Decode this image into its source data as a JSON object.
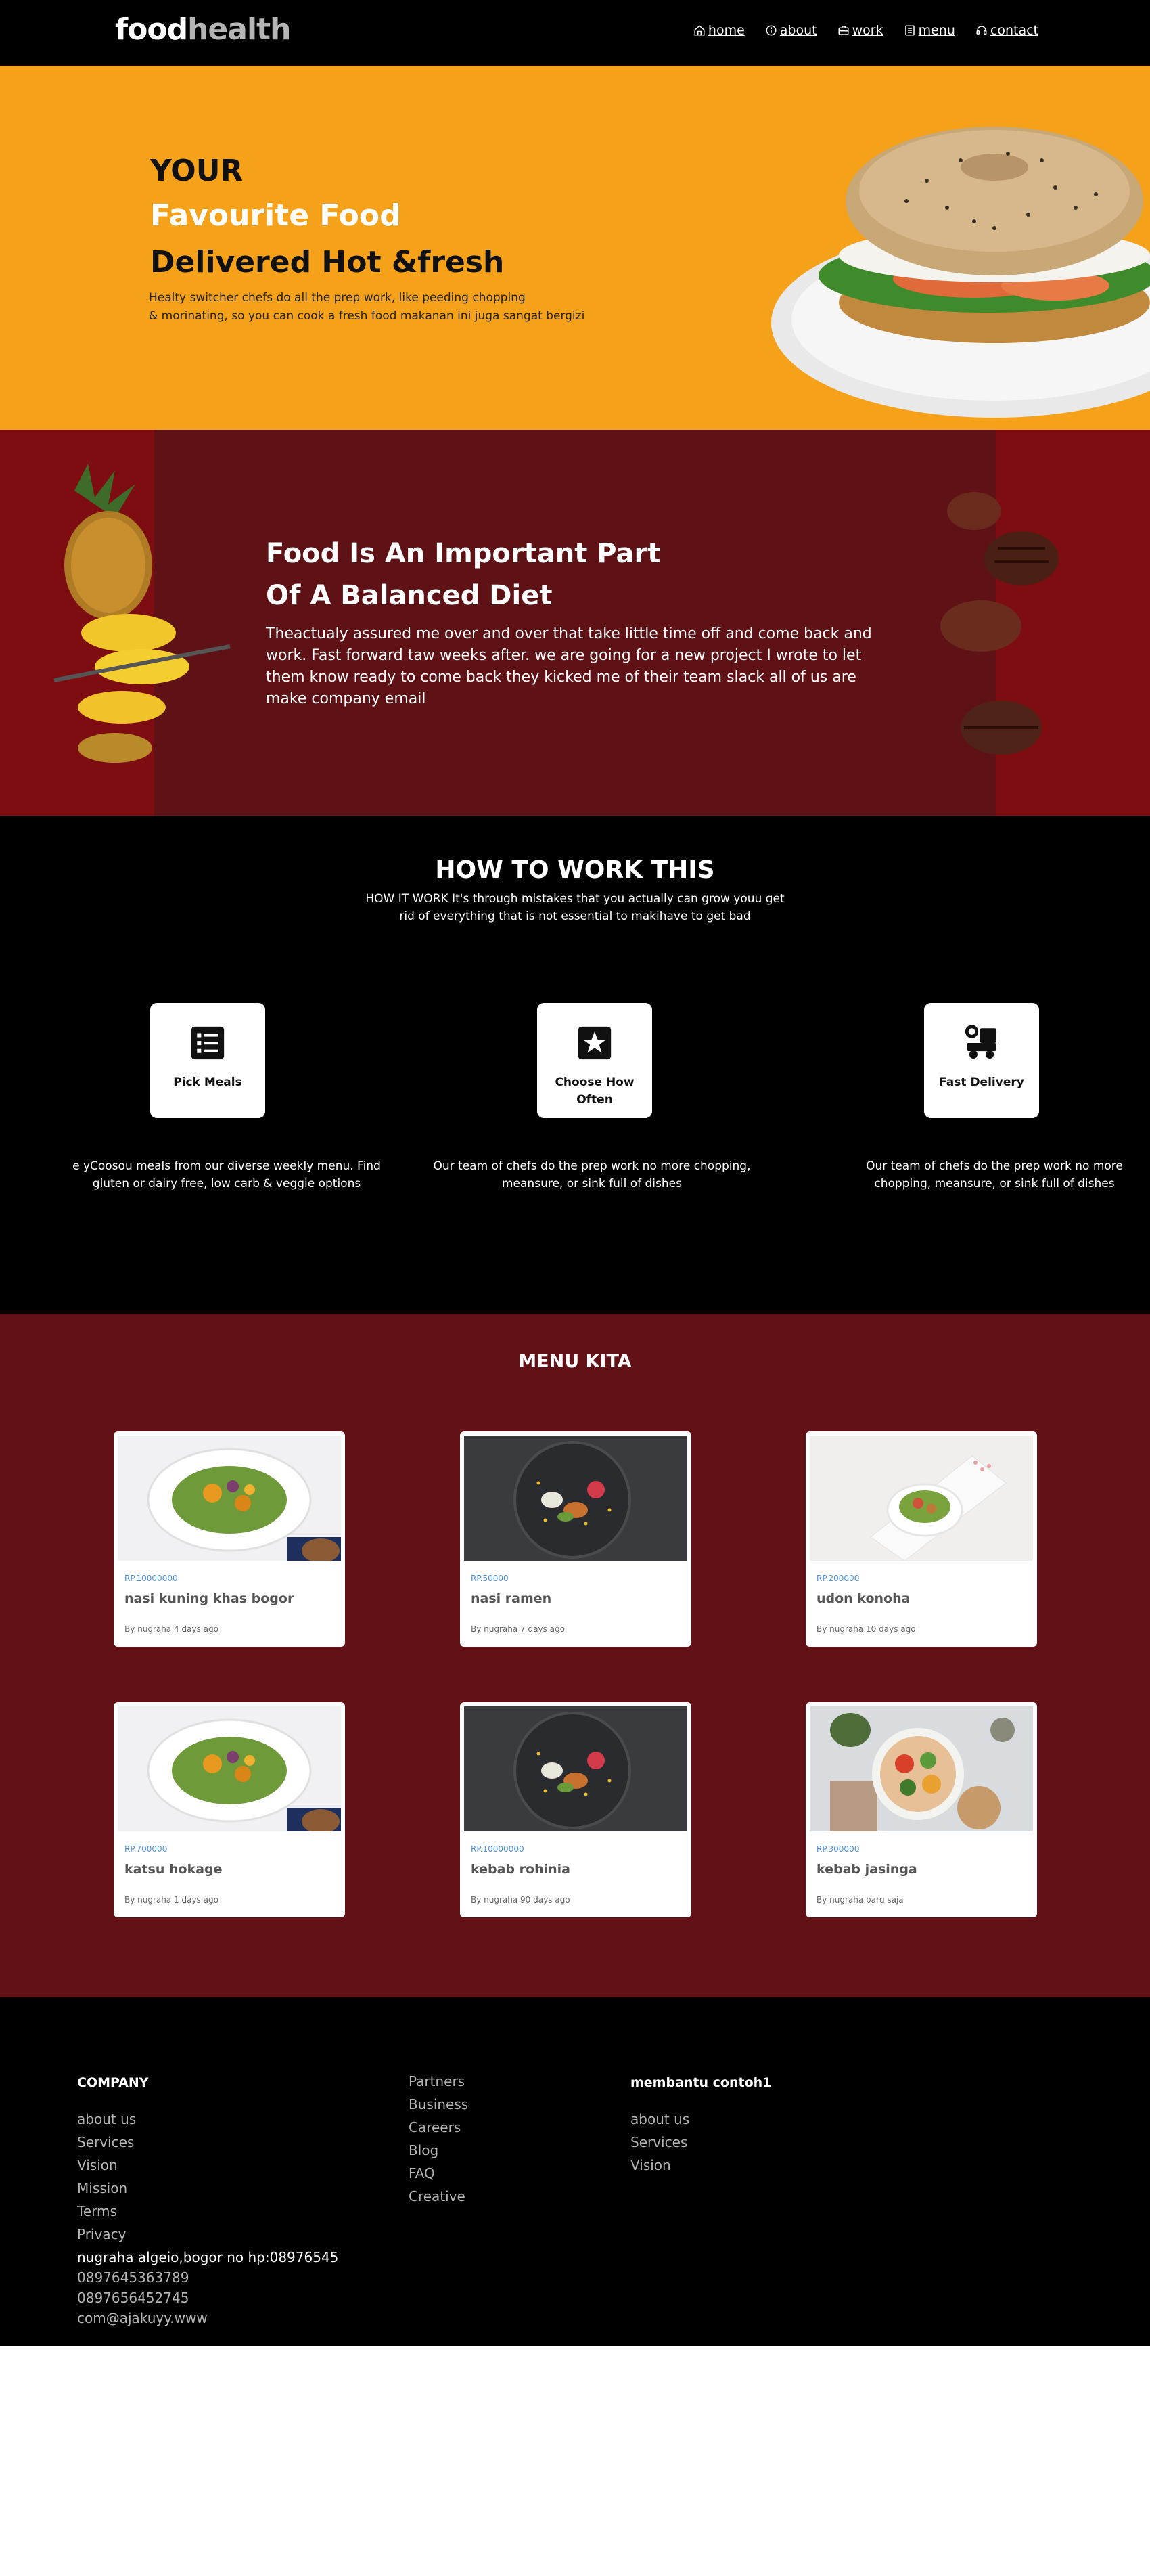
{
  "brand": {
    "part1": "food",
    "part2": "health"
  },
  "nav": [
    {
      "label": "home",
      "icon": "home-icon"
    },
    {
      "label": "about",
      "icon": "info-icon"
    },
    {
      "label": "work",
      "icon": "briefcase-icon"
    },
    {
      "label": "menu",
      "icon": "menu-list-icon"
    },
    {
      "label": "contact",
      "icon": "headset-icon"
    }
  ],
  "hero": {
    "line1": "YOUR",
    "line2": "Favourite Food",
    "line3": "Delivered Hot &fresh",
    "desc_line1": "Healty switcher chefs do all the prep work, like peeding chopping",
    "desc_line2": "& morinating, so you can cook a fresh food makanan ini juga sangat bergizi"
  },
  "diet": {
    "title_line1": "Food Is An Important Part",
    "title_line2": "Of A Balanced Diet",
    "text": "Theactualy assured me over and over that take little time off and come back and work. Fast forward taw weeks after. we are going for a new project I wrote to let them know ready to come back they kicked me of their team slack all of us are make company email"
  },
  "how": {
    "title": "HOW TO WORK THIS",
    "subtitle": "HOW IT WORK It's through mistakes that you actually can grow youu get rid of everything that is not essential to makihave to get bad",
    "steps": [
      {
        "label": "Pick Meals",
        "icon": "list-icon",
        "desc": "e yCoosou meals from our diverse weekly menu. Find gluten or dairy free, low carb & veggie options"
      },
      {
        "label": "Choose How Often",
        "icon": "star-icon",
        "desc": "Our team of chefs do the prep work no more chopping, meansure, or sink full of dishes"
      },
      {
        "label": "Fast Delivery",
        "icon": "delivery-icon",
        "desc": "Our team of chefs do the prep work no more chopping, meansure, or sink full of dishes"
      }
    ]
  },
  "menu": {
    "title": "MENU KITA",
    "items": [
      {
        "price": "RP.10000000",
        "name": "nasi kuning khas bogor",
        "meta": "By nugraha 4 days ago",
        "image": "salad-bowl-image"
      },
      {
        "price": "RP.50000",
        "name": "nasi ramen",
        "meta": "By nugraha 7 days ago",
        "image": "dark-plate-image"
      },
      {
        "price": "RP.200000",
        "name": "udon konoha",
        "meta": "By nugraha 10 days ago",
        "image": "salad-tray-image"
      },
      {
        "price": "RP.700000",
        "name": "katsu hokage",
        "meta": "By nugraha 1 days ago",
        "image": "salad-bowl-image"
      },
      {
        "price": "RP.10000000",
        "name": "kebab rohinia",
        "meta": "By nugraha 90 days ago",
        "image": "dark-plate-image"
      },
      {
        "price": "RP.300000",
        "name": "kebab jasinga",
        "meta": "By nugraha baru saja",
        "image": "veggie-bowl-image"
      }
    ]
  },
  "footer": {
    "col1": {
      "title": "COMPANY",
      "links": [
        "about us",
        "Services",
        "Vision",
        "Mission",
        "Terms",
        "Privacy"
      ],
      "address": "nugraha algeio,bogor no hp:08976545",
      "contacts": [
        "0897645363789",
        "0897656452745",
        "com@ajakuyy.www"
      ]
    },
    "col2": {
      "links": [
        "Partners",
        "Business",
        "Careers",
        "Blog",
        "FAQ",
        "Creative"
      ]
    },
    "col3": {
      "title": "membantu contoh1",
      "links": [
        "about us",
        "Services",
        "Vision"
      ]
    }
  },
  "colors": {
    "hero_bg": "#f5a119",
    "diet_outer": "#7d0d10",
    "diet_inner": "#5e1216",
    "menu_bg": "#621216",
    "price_blue": "#4a90d9"
  }
}
